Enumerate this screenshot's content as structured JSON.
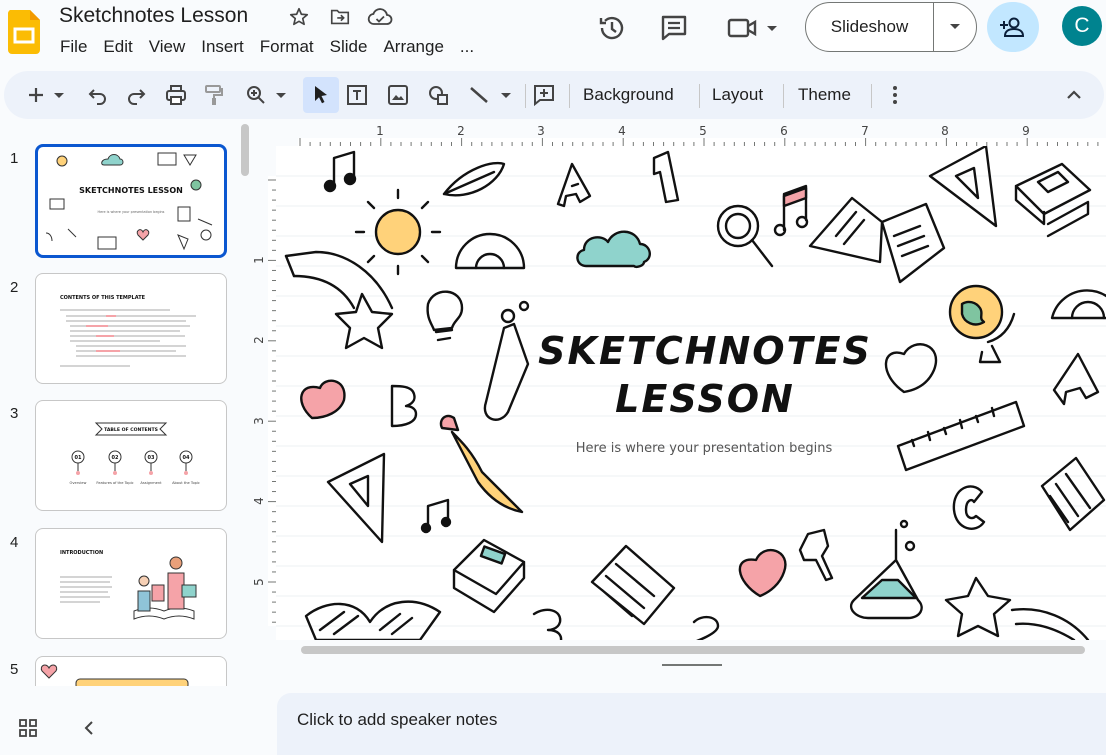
{
  "app": {
    "doc_title": "Sketchnotes Lesson",
    "menu": [
      "File",
      "Edit",
      "View",
      "Insert",
      "Format",
      "Slide",
      "Arrange",
      "..."
    ],
    "slideshow_label": "Slideshow",
    "avatar_initial": "C",
    "brand_color": "#fbbc04"
  },
  "toolbar": {
    "background_label": "Background",
    "layout_label": "Layout",
    "theme_label": "Theme"
  },
  "filmstrip": {
    "slides": [
      {
        "number": "1",
        "title": "SKETCHNOTES LESSON",
        "subtitle": "Here is where your presentation begins"
      },
      {
        "number": "2",
        "title": "CONTENTS OF THIS TEMPLATE"
      },
      {
        "number": "3",
        "title": "TABLE OF CONTENTS",
        "items": [
          {
            "num": "01",
            "label": "Overview"
          },
          {
            "num": "02",
            "label": "Features of the Topic"
          },
          {
            "num": "03",
            "label": "Assignment"
          },
          {
            "num": "04",
            "label": "About the Topic"
          }
        ]
      },
      {
        "number": "4",
        "title": "INTRODUCTION"
      },
      {
        "number": "5"
      }
    ]
  },
  "ruler": {
    "horizontal": [
      "1",
      "2",
      "3",
      "4",
      "5",
      "6",
      "7",
      "8",
      "9"
    ],
    "vertical": [
      "1",
      "2",
      "3",
      "4",
      "5"
    ]
  },
  "slide": {
    "title_line1": "SKETCHNOTES",
    "title_line2": "LESSON",
    "subtitle": "Here is where your presentation begins",
    "letters": [
      "A",
      "B",
      "A",
      "C",
      "1",
      "3",
      "2"
    ]
  },
  "notes": {
    "placeholder": "Click to add speaker notes"
  },
  "colors": {
    "accent_blue": "#0b57d0",
    "doodle_pink": "#f5a3a8",
    "doodle_teal": "#8fd3cc",
    "doodle_yellow": "#ffd27a"
  }
}
